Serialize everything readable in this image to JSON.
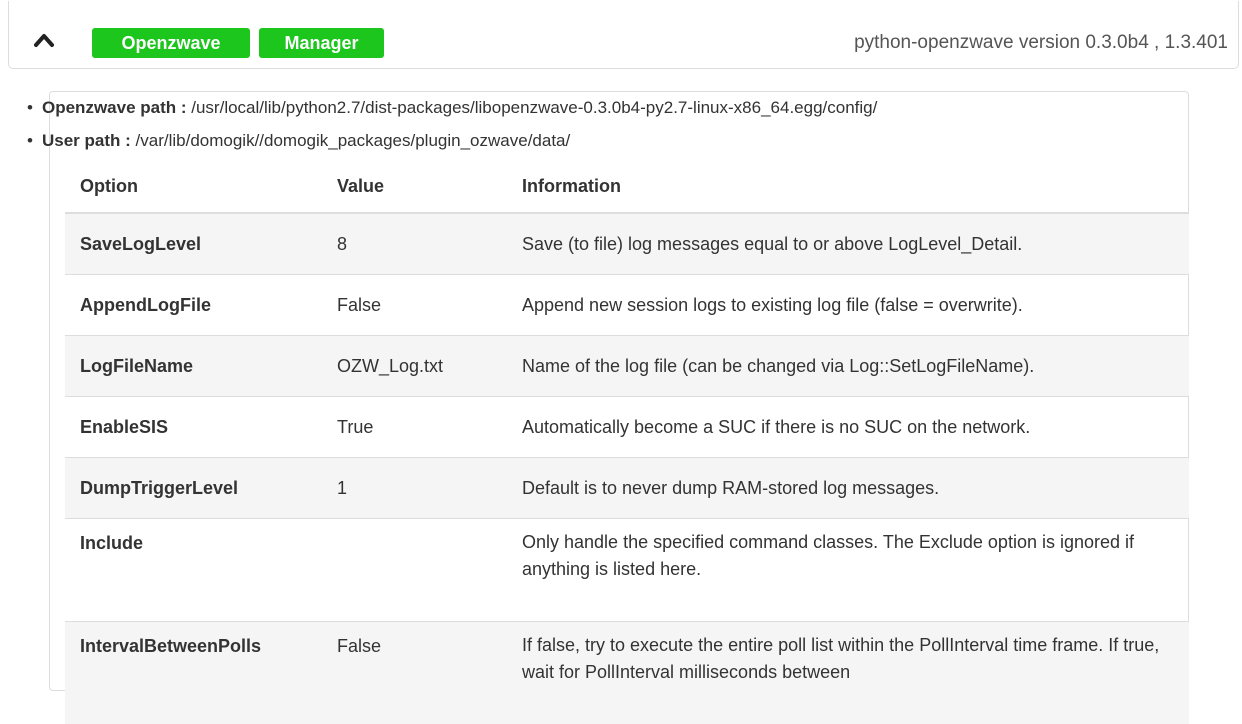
{
  "header": {
    "badges": [
      "Openzwave",
      "Manager"
    ],
    "version": "python-openzwave version 0.3.0b4 , 1.3.401"
  },
  "paths": [
    {
      "label": "Openzwave path :",
      "value": " /usr/local/lib/python2.7/dist-packages/libopenzwave-0.3.0b4-py2.7-linux-x86_64.egg/config/"
    },
    {
      "label": "User path :",
      "value": " /var/lib/domogik//domogik_packages/plugin_ozwave/data/"
    }
  ],
  "table": {
    "headers": [
      "Option",
      "Value",
      "Information"
    ],
    "rows": [
      {
        "option": "SaveLogLevel",
        "value": "8",
        "info": "Save (to file) log messages equal to or above LogLevel_Detail."
      },
      {
        "option": "AppendLogFile",
        "value": "False",
        "info": "Append new session logs to existing log file (false = overwrite)."
      },
      {
        "option": "LogFileName",
        "value": "OZW_Log.txt",
        "info": "Name of the log file (can be changed via Log::SetLogFileName)."
      },
      {
        "option": "EnableSIS",
        "value": "True",
        "info": "Automatically become a SUC if there is no SUC on the network."
      },
      {
        "option": "DumpTriggerLevel",
        "value": "1",
        "info": "Default is to never dump RAM-stored log messages."
      },
      {
        "option": "Include",
        "value": "",
        "info": "Only handle the specified command classes. The Exclude option is ignored if anything is listed here."
      },
      {
        "option": "IntervalBetweenPolls",
        "value": "False",
        "info": "If false, try to execute the entire poll list within the PollInterval time frame. If true, wait for PollInterval milliseconds between"
      }
    ]
  },
  "icons": {
    "collapse": "chevron-up-icon"
  },
  "colors": {
    "badge": "#1cc61c",
    "row_stripe": "#f5f5f5",
    "border": "#dddddd"
  }
}
